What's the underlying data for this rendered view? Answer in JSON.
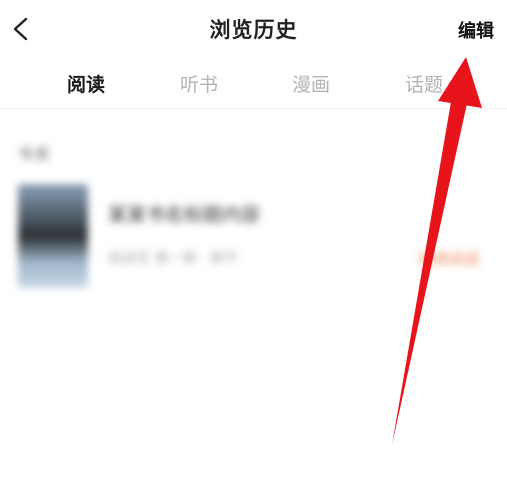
{
  "header": {
    "title": "浏览历史",
    "edit_label": "编辑",
    "back_icon": "chevron-left-icon"
  },
  "tabs": [
    {
      "label": "阅读",
      "active": true
    },
    {
      "label": "听书",
      "active": false
    },
    {
      "label": "漫画",
      "active": false
    },
    {
      "label": "话题",
      "active": false
    }
  ],
  "history": {
    "date_label": "今天",
    "items": [
      {
        "title": "某某书名标题内容",
        "meta": "阅读至 第一章 · 章节",
        "action_label": "继续阅读"
      }
    ]
  },
  "colors": {
    "annotation_arrow": "#e8141b",
    "active_tab": "#1a1a1a",
    "inactive_tab": "#b3b3b3"
  }
}
